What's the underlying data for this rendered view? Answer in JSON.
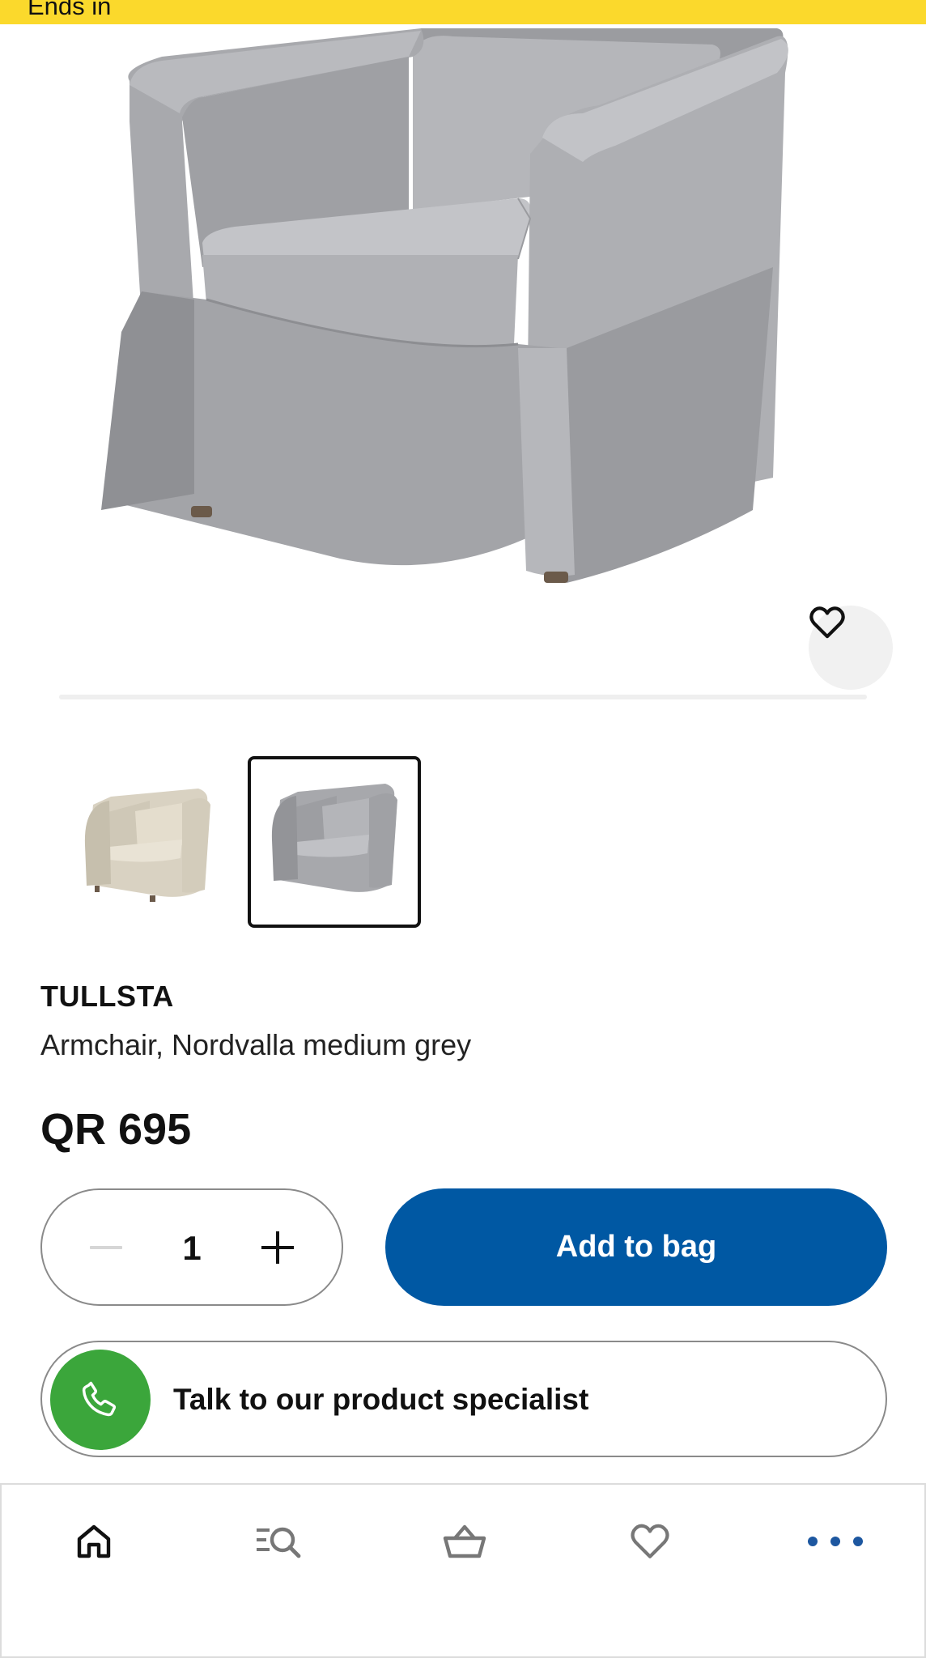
{
  "promo_banner": {
    "text": "Ends in"
  },
  "product": {
    "brand": "TULLSTA",
    "description": "Armchair, Nordvalla medium grey",
    "price": "QR 695",
    "quantity": "1",
    "add_to_bag_label": "Add to bag",
    "selected_thumbnail": 2
  },
  "thumbnails": [
    {
      "variant": "beige"
    },
    {
      "variant": "medium grey",
      "selected": true
    }
  ],
  "specialist": {
    "label": "Talk to our product specialist"
  },
  "colors": {
    "banner": "#fbd92c",
    "primary": "#0058a3",
    "phone": "#3ba63b",
    "nav_active": "#1d57a0"
  },
  "icons": {
    "favorite": "heart-icon",
    "minus": "minus-icon",
    "plus": "plus-icon",
    "phone": "phone-icon",
    "nav": [
      "home-icon",
      "search-list-icon",
      "shopping-basket-icon",
      "heart-icon",
      "more-dots-icon"
    ]
  }
}
